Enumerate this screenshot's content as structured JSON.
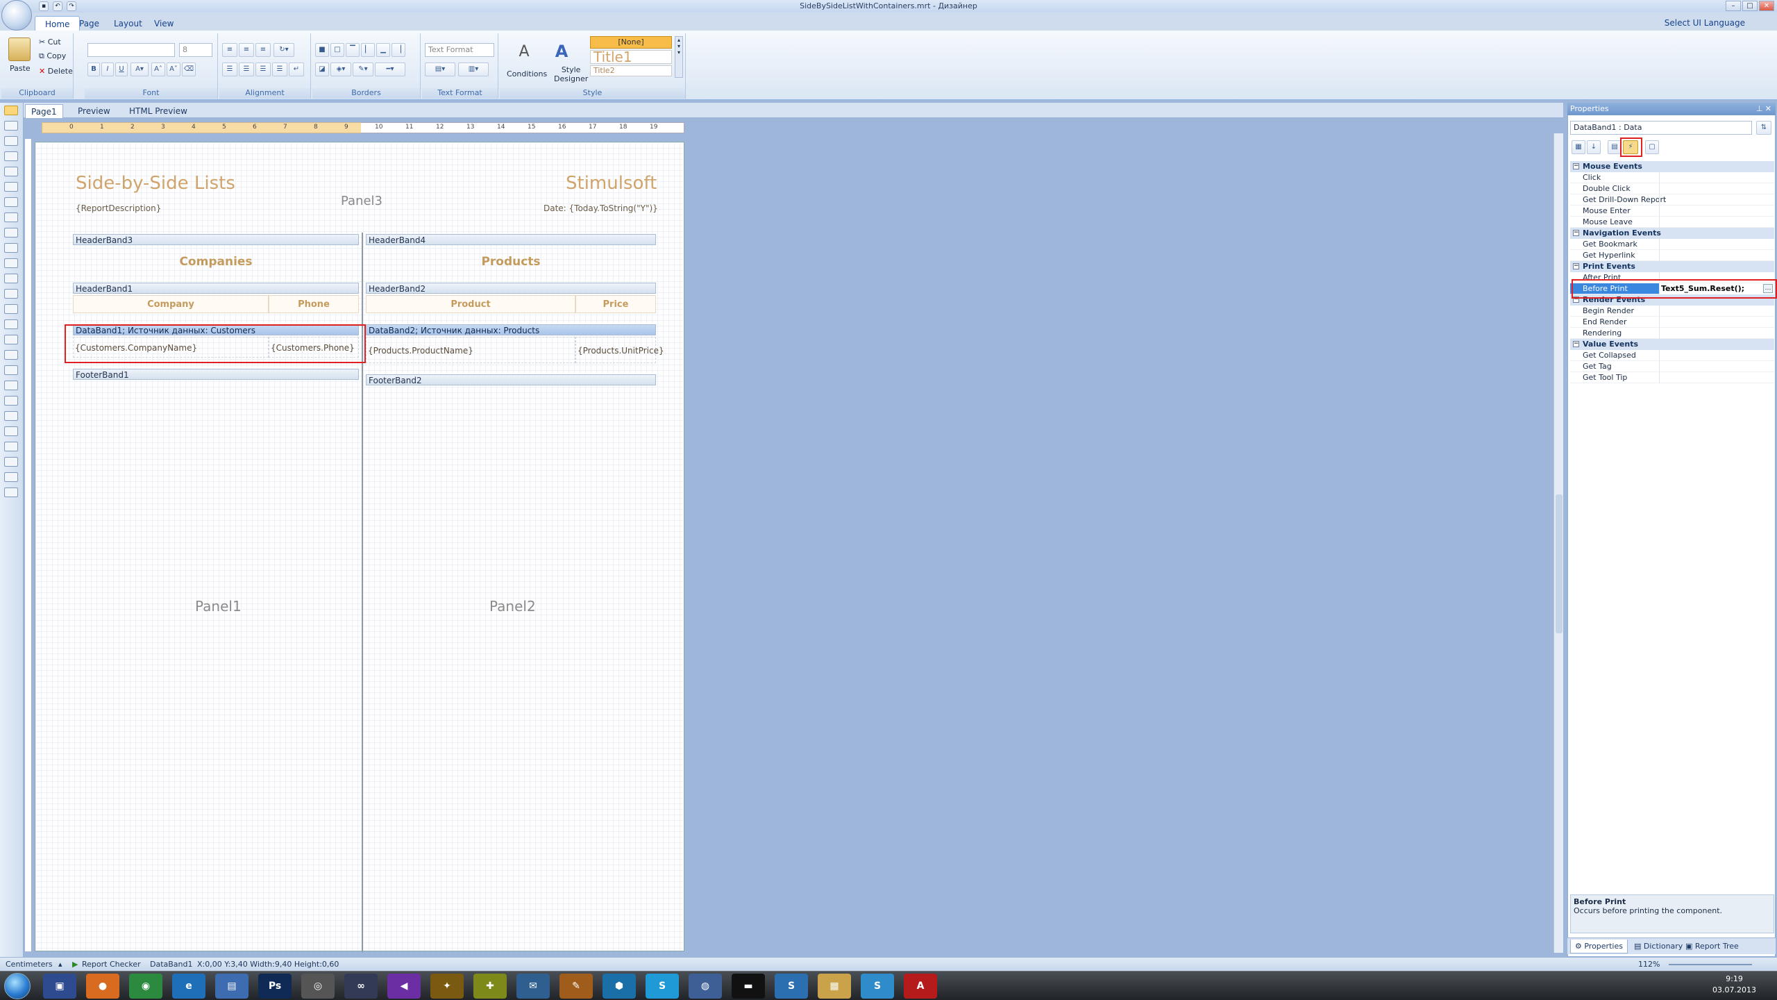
{
  "window": {
    "title": "SideBySideListWithContainers.mrt - Дизайнер"
  },
  "menu": {
    "tabs": [
      "Home",
      "Page",
      "Layout",
      "View"
    ],
    "ui_language": "Select UI Language"
  },
  "ribbon": {
    "clipboard": {
      "label": "Clipboard",
      "paste": "Paste",
      "cut": "Cut",
      "copy": "Copy",
      "delete": "Delete"
    },
    "font": {
      "label": "Font",
      "size": "8"
    },
    "alignment": {
      "label": "Alignment"
    },
    "borders": {
      "label": "Borders"
    },
    "text_format": {
      "label": "Text Format",
      "value": "Text Format"
    },
    "style": {
      "label": "Style",
      "conditions": "Conditions",
      "style_designer_1": "Style",
      "style_designer_2": "Designer",
      "styles": [
        "[None]",
        "Title1",
        "Title2"
      ]
    }
  },
  "page_tabs": [
    "Page1",
    "Preview",
    "HTML Preview"
  ],
  "ruler": {
    "ticks": [
      "0",
      "1",
      "2",
      "3",
      "4",
      "5",
      "6",
      "7",
      "8",
      "9",
      "10",
      "11",
      "12",
      "13",
      "14",
      "15",
      "16",
      "17",
      "18",
      "19"
    ]
  },
  "report": {
    "title": "Side-by-Side Lists",
    "brand": "Stimulsoft",
    "panel3": "Panel3",
    "description": "{ReportDescription}",
    "date": "Date: {Today.ToString(\"Y\")}",
    "left": {
      "header_band3": "HeaderBand3",
      "heading": "Companies",
      "header_band1": "HeaderBand1",
      "col1": "Company",
      "col2": "Phone",
      "data_band": "DataBand1; Источник данных: Customers",
      "cell1": "{Customers.CompanyName}",
      "cell2": "{Customers.Phone}",
      "footer_band": "FooterBand1",
      "panel": "Panel1"
    },
    "right": {
      "header_band4": "HeaderBand4",
      "heading": "Products",
      "header_band2": "HeaderBand2",
      "col1": "Product",
      "col2": "Price",
      "data_band": "DataBand2; Источник данных: Products",
      "cell1": "{Products.ProductName}",
      "cell2": "{Products.UnitPrice}",
      "footer_band": "FooterBand2",
      "panel": "Panel2"
    }
  },
  "properties": {
    "header": "Properties",
    "selector": "DataBand1 : Data",
    "groups": [
      {
        "name": "Mouse Events",
        "items": [
          {
            "label": "Click",
            "value": ""
          },
          {
            "label": "Double Click",
            "value": ""
          },
          {
            "label": "Get Drill-Down Report",
            "value": ""
          },
          {
            "label": "Mouse Enter",
            "value": ""
          },
          {
            "label": "Mouse Leave",
            "value": ""
          }
        ]
      },
      {
        "name": "Navigation Events",
        "items": [
          {
            "label": "Get Bookmark",
            "value": ""
          },
          {
            "label": "Get Hyperlink",
            "value": ""
          }
        ]
      },
      {
        "name": "Print Events",
        "items": [
          {
            "label": "After Print",
            "value": ""
          },
          {
            "label": "Before Print",
            "value": "Text5_Sum.Reset();"
          }
        ]
      },
      {
        "name": "Render Events",
        "items": [
          {
            "label": "Begin Render",
            "value": ""
          },
          {
            "label": "End Render",
            "value": ""
          },
          {
            "label": "Rendering",
            "value": ""
          }
        ]
      },
      {
        "name": "Value Events",
        "items": [
          {
            "label": "Get Collapsed",
            "value": ""
          },
          {
            "label": "Get Tag",
            "value": ""
          },
          {
            "label": "Get Tool Tip",
            "value": ""
          }
        ]
      }
    ],
    "desc_title": "Before Print",
    "desc_text": "Occurs before printing the component.",
    "bottom_tabs": [
      "Properties",
      "Dictionary",
      "Report Tree"
    ]
  },
  "status": {
    "units": "Centimeters",
    "checker": "Report Checker",
    "component": "DataBand1",
    "coords": "X:0,00  Y:3,40  Width:9,40  Height:0,60",
    "zoom": "112%"
  },
  "taskbar": {
    "time": "9:19",
    "date": "03.07.2013"
  }
}
